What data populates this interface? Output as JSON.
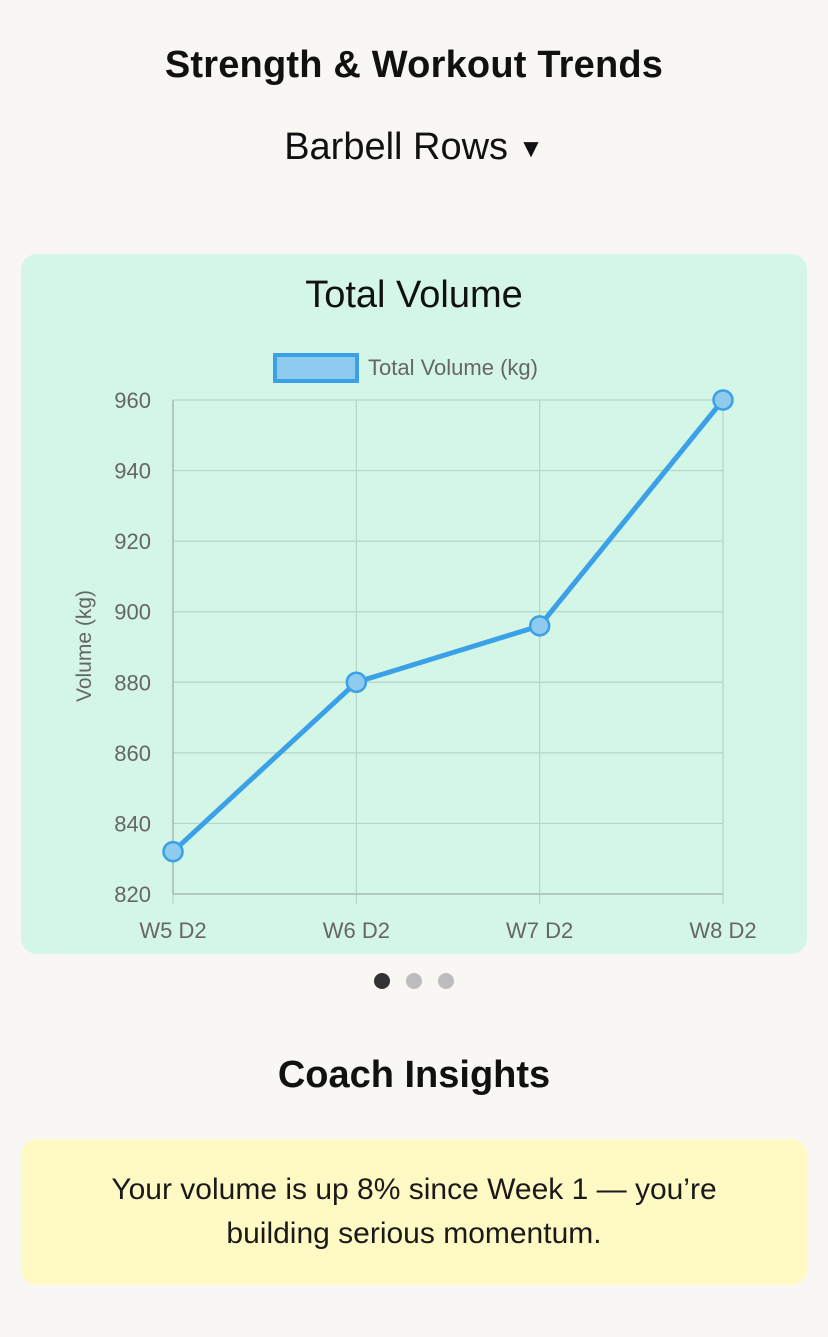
{
  "header": {
    "title": "Strength & Workout Trends",
    "exercise": "Barbell Rows",
    "caret": "▼"
  },
  "chart_card": {
    "title": "Total Volume"
  },
  "chart_data": {
    "type": "line",
    "categories": [
      "W5 D2",
      "W6 D2",
      "W7 D2",
      "W8 D2"
    ],
    "series": [
      {
        "name": "Total Volume (kg)",
        "values": [
          832,
          880,
          896,
          960
        ],
        "color": "#3aa0e8",
        "point_fill": "#8ecbef"
      }
    ],
    "title": "Total Volume",
    "xlabel": "",
    "ylabel": "Volume (kg)",
    "ylim": [
      820,
      960
    ],
    "yticks": [
      820,
      840,
      860,
      880,
      900,
      920,
      940,
      960
    ],
    "grid": true,
    "legend": "top-center"
  },
  "pager": {
    "count": 3,
    "active": 0
  },
  "insights": {
    "title": "Coach Insights",
    "text": "Your volume is up 8% since Week 1 — you’re building serious momentum."
  },
  "colors": {
    "background": "#f8f7f3",
    "chart_card": "#d4f6e6",
    "insight_card": "#fff9c4",
    "line": "#3aa0e8",
    "grid": "#b5d6c6",
    "axis_text": "#666666"
  }
}
